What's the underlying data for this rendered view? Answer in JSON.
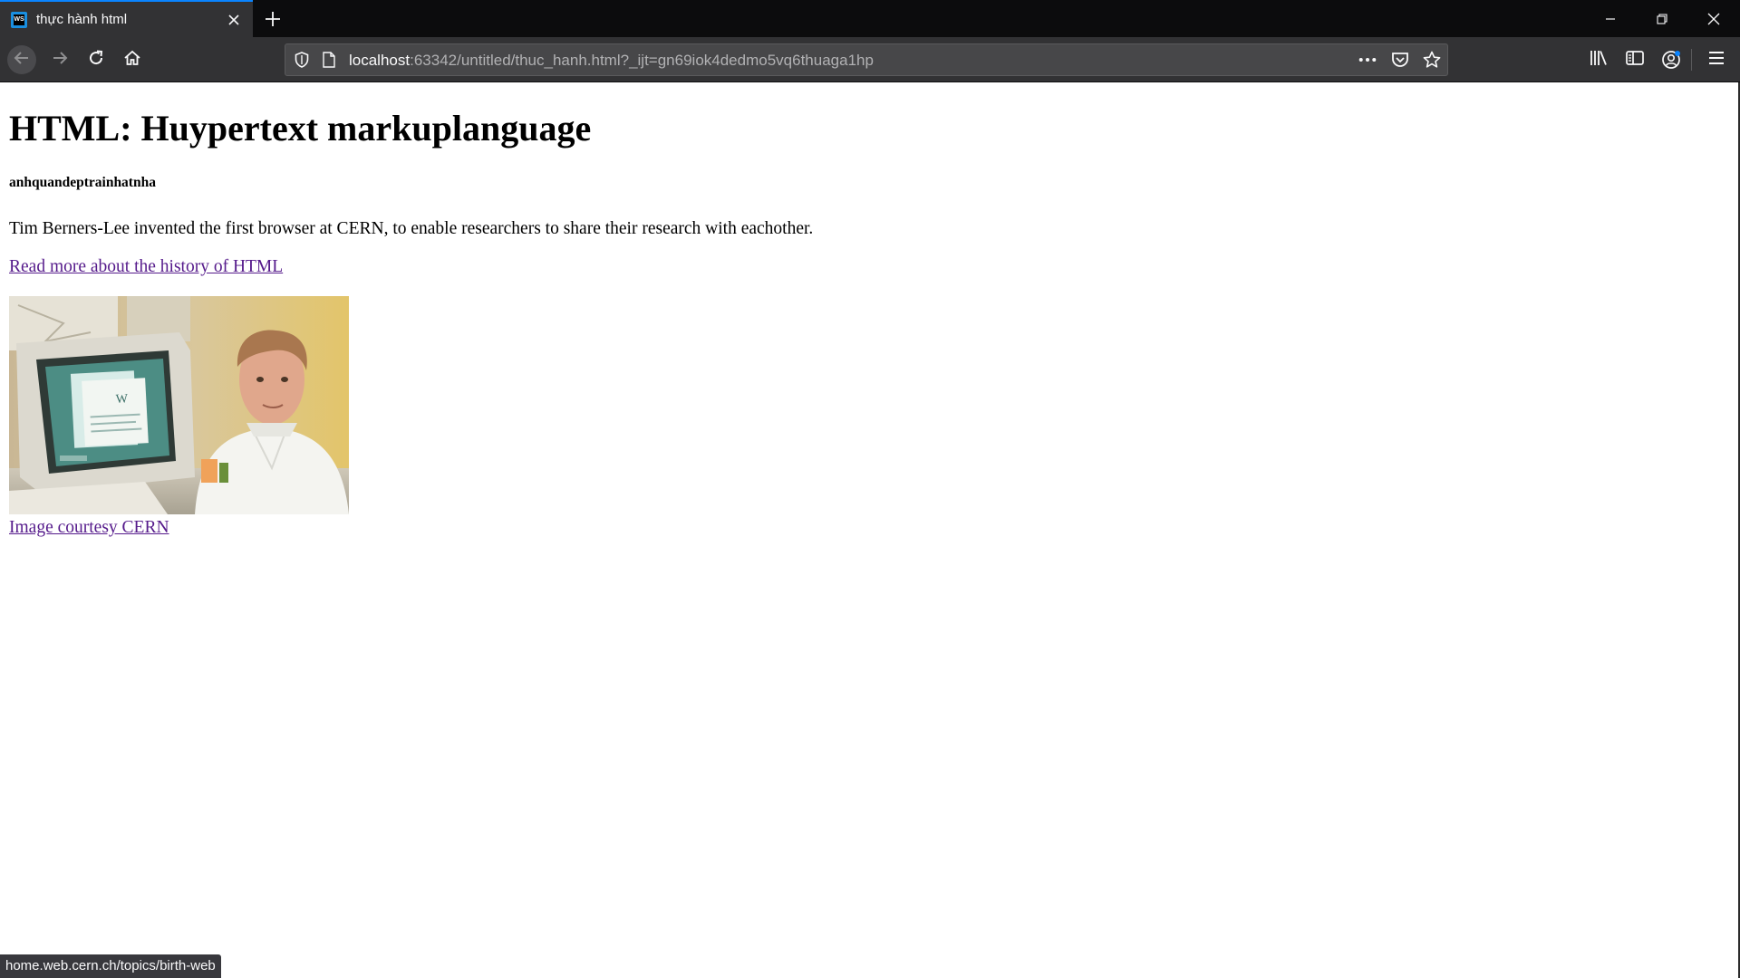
{
  "browser": {
    "tab": {
      "title": "thực hành html",
      "favicon_text": "WS"
    },
    "url": {
      "host": "localhost",
      "path": ":63342/untitled/thuc_hanh.html?_ijt=gn69iok4dedmo5vq6thuaga1hp"
    },
    "status_url": "home.web.cern.ch/topics/birth-web",
    "icons": {
      "back": "arrow-left-icon",
      "forward": "arrow-right-icon",
      "reload": "reload-icon",
      "home": "home-icon",
      "tracking": "shield-icon",
      "page": "page-icon",
      "page_actions": "more-icon",
      "pocket": "pocket-icon",
      "bookmark": "star-icon",
      "library": "library-icon",
      "sidebar": "sidebar-icon",
      "account": "account-icon",
      "menu": "hamburger-icon"
    },
    "colors": {
      "tab_accent": "#0a84ff",
      "toolbar": "#323234",
      "urlbar": "#474749",
      "link_visited": "#551a8b"
    }
  },
  "page": {
    "heading": "HTML: Huypertext markuplanguage",
    "subheading": "anhquandeptrainhatnha",
    "paragraph": "Tim Berners-Lee invented the first browser at CERN, to enable researchers to share their research with eachother.",
    "history_link": "Read more about the history of HTML",
    "image_caption_link": "Image courtesy CERN"
  }
}
